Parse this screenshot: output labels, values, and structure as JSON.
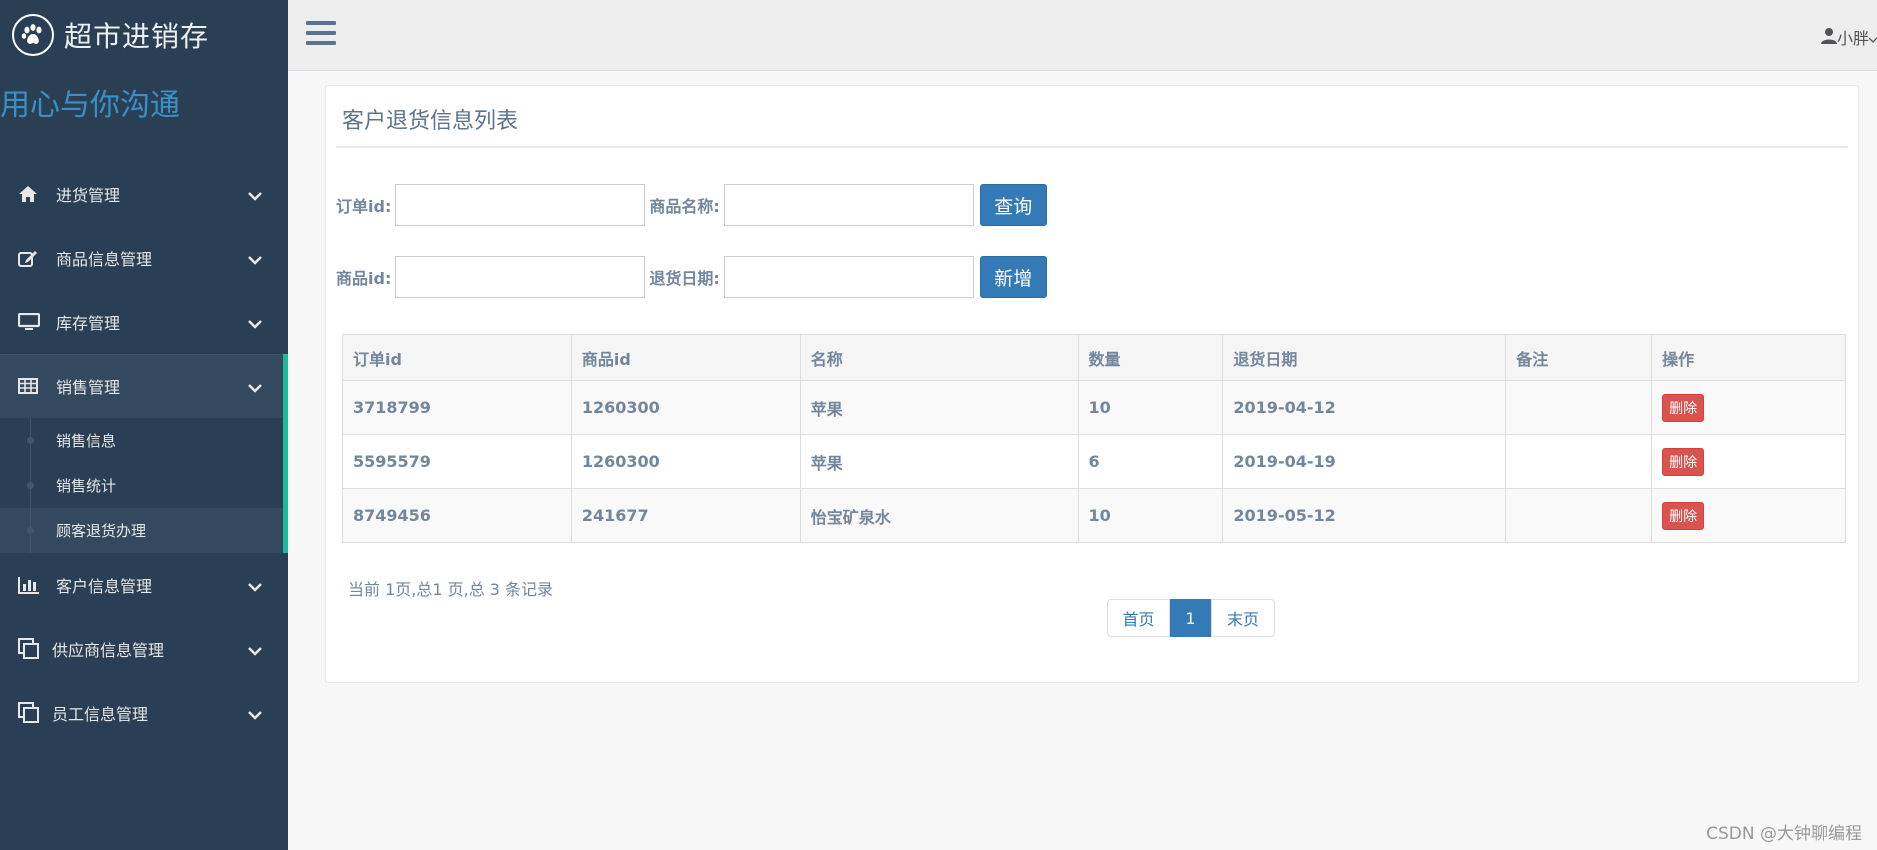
{
  "brand": {
    "title": "超市进销存",
    "slogan": "用心与你沟通",
    "logo_icon": "paw-icon"
  },
  "sidebar": {
    "items": [
      {
        "label": "进货管理",
        "icon": "home-icon"
      },
      {
        "label": "商品信息管理",
        "icon": "edit-icon"
      },
      {
        "label": "库存管理",
        "icon": "desktop-icon"
      },
      {
        "label": "销售管理",
        "icon": "table-icon",
        "expanded": true,
        "children": [
          "销售信息",
          "销售统计",
          "顾客退货办理"
        ]
      },
      {
        "label": "客户信息管理",
        "icon": "bar-chart-icon"
      },
      {
        "label": "供应商信息管理",
        "icon": "clone-icon"
      },
      {
        "label": "员工信息管理",
        "icon": "clone-icon"
      }
    ]
  },
  "topbar": {
    "user": "小胖"
  },
  "panel": {
    "title": "客户退货信息列表"
  },
  "form": {
    "order_id_label": "订单id:",
    "product_name_label": "商品名称:",
    "search_button": "查询",
    "product_id_label": "商品id:",
    "return_date_label": "退货日期:",
    "add_button": "新增"
  },
  "table": {
    "headers": [
      "订单id",
      "商品id",
      "名称",
      "数量",
      "退货日期",
      "备注",
      "操作"
    ],
    "rows": [
      {
        "order_id": "3718799",
        "product_id": "1260300",
        "name": "苹果",
        "qty": "10",
        "date": "2019-04-12",
        "note": "",
        "action": "删除"
      },
      {
        "order_id": "5595579",
        "product_id": "1260300",
        "name": "苹果",
        "qty": "6",
        "date": "2019-04-19",
        "note": "",
        "action": "删除"
      },
      {
        "order_id": "8749456",
        "product_id": "241677",
        "name": "怡宝矿泉水",
        "qty": "10",
        "date": "2019-05-12",
        "note": "",
        "action": "删除"
      }
    ]
  },
  "pagination": {
    "info": "当前 1页,总1 页,总 3 条记录",
    "first": "首页",
    "current": "1",
    "last": "末页"
  },
  "watermark": "CSDN @大钟聊编程",
  "colors": {
    "sidebar_bg": "#2a3f54",
    "accent": "#1abb9c",
    "primary": "#337ab7",
    "danger": "#d9534f"
  }
}
